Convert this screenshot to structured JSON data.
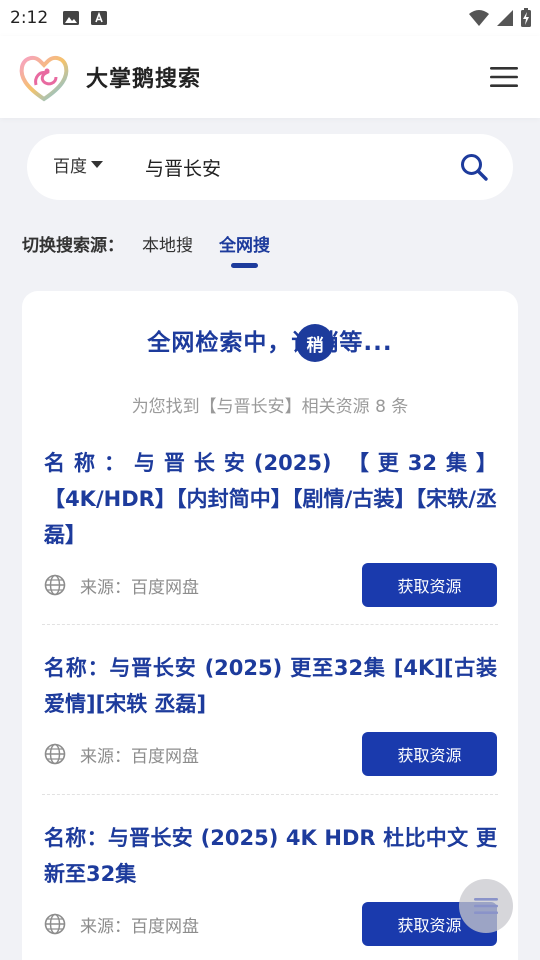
{
  "status_bar": {
    "time": "2:12",
    "icons": [
      "image-icon",
      "keyboard-a-icon",
      "wifi-icon",
      "signal-icon",
      "battery-charging-icon"
    ]
  },
  "header": {
    "title": "大掌鹅搜索",
    "logo_icon": "swan-heart-logo",
    "menu_icon": "hamburger-menu-icon"
  },
  "search": {
    "engine": "百度",
    "query": "与晋长安",
    "button_icon": "search-icon"
  },
  "source_switch": {
    "label": "切换搜索源：",
    "tabs": [
      {
        "label": "本地搜",
        "active": false
      },
      {
        "label": "全网搜",
        "active": true
      }
    ]
  },
  "results_panel": {
    "searching_text": "全网检索中，请稍等...",
    "loading_badge": "稍",
    "found_text": "为您找到【与晋长安】相关资源 8 条",
    "items": [
      {
        "title": "名称：与晋长安(2025) 【更32集】【4K/HDR】【内封简中】【剧情/古装】【宋轶/丞磊】",
        "source": "来源：百度网盘",
        "button": "获取资源"
      },
      {
        "title": "名称：与晋长安 (2025) 更至32集 [4K][古装爱情][宋轶 丞磊]",
        "source": "来源：百度网盘",
        "button": "获取资源"
      },
      {
        "title": "名称：与晋长安 (2025) 4K HDR 杜比中文 更新至32集",
        "source": "来源：百度网盘",
        "button": "获取资源"
      }
    ]
  },
  "colors": {
    "accent": "#1d3b9c",
    "button": "#1a3aad",
    "background": "#f1f2f6"
  }
}
